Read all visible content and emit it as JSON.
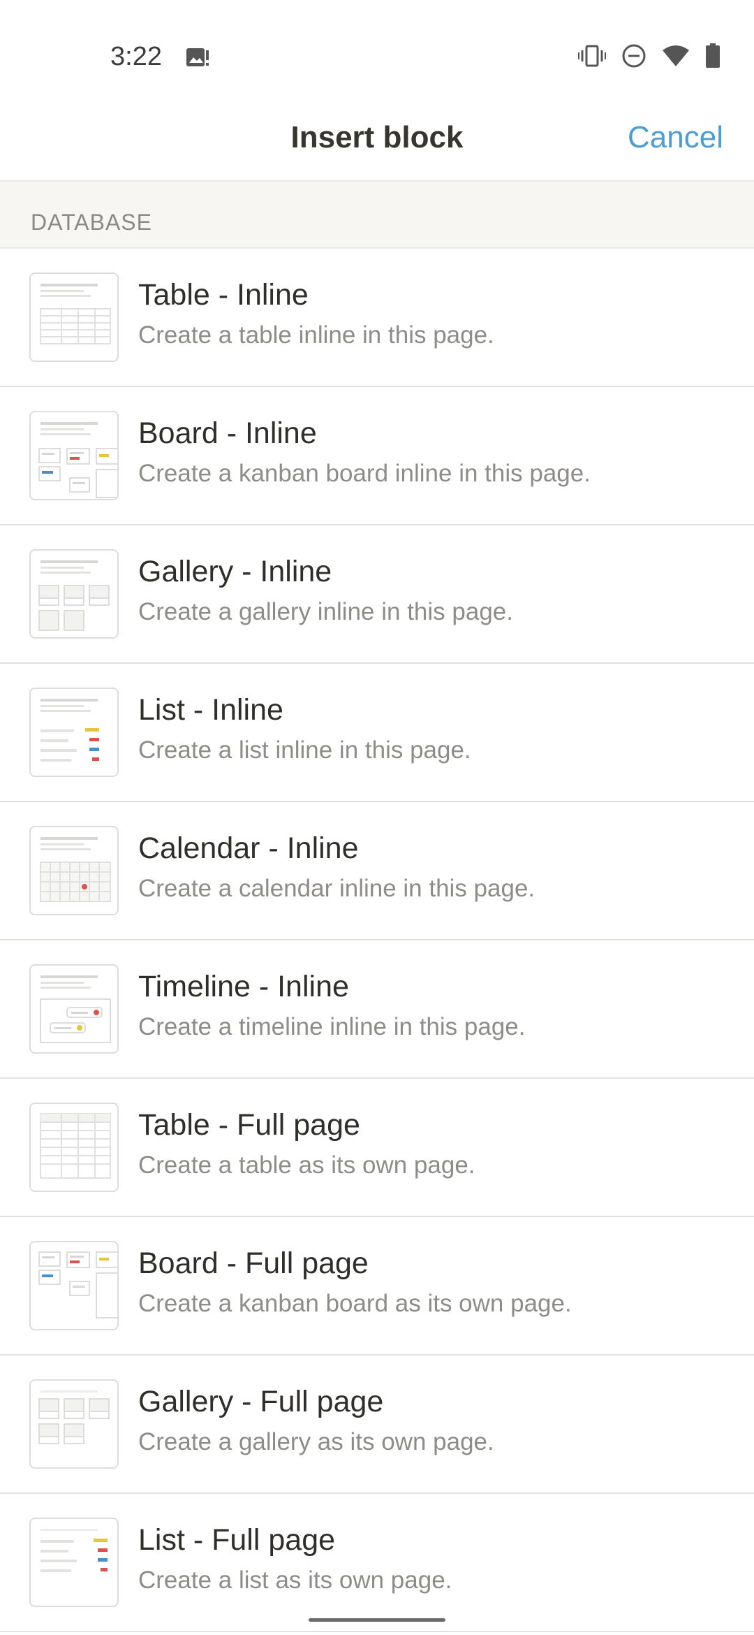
{
  "status_bar": {
    "time": "3:22",
    "icons": [
      "image-notification-icon",
      "vibrate-icon",
      "do-not-disturb-icon",
      "wifi-icon",
      "battery-icon"
    ]
  },
  "header": {
    "title": "Insert block",
    "cancel_label": "Cancel",
    "accent_color": "#4a9ed3"
  },
  "section": {
    "label": "DATABASE"
  },
  "items": [
    {
      "title": "Table - Inline",
      "description": "Create a table inline in this page.",
      "icon": "table-inline-icon"
    },
    {
      "title": "Board - Inline",
      "description": "Create a kanban board inline in this page.",
      "icon": "board-inline-icon"
    },
    {
      "title": "Gallery - Inline",
      "description": "Create a gallery inline in this page.",
      "icon": "gallery-inline-icon"
    },
    {
      "title": "List - Inline",
      "description": "Create a list inline in this page.",
      "icon": "list-inline-icon"
    },
    {
      "title": "Calendar - Inline",
      "description": "Create a calendar inline in this page.",
      "icon": "calendar-inline-icon"
    },
    {
      "title": "Timeline - Inline",
      "description": "Create a timeline inline in this page.",
      "icon": "timeline-inline-icon"
    },
    {
      "title": "Table - Full page",
      "description": "Create a table as its own page.",
      "icon": "table-full-page-icon"
    },
    {
      "title": "Board - Full page",
      "description": "Create a kanban board as its own page.",
      "icon": "board-full-page-icon"
    },
    {
      "title": "Gallery - Full page",
      "description": "Create a gallery as its own page.",
      "icon": "gallery-full-page-icon"
    },
    {
      "title": "List - Full page",
      "description": "Create a list as its own page.",
      "icon": "list-full-page-icon"
    }
  ]
}
